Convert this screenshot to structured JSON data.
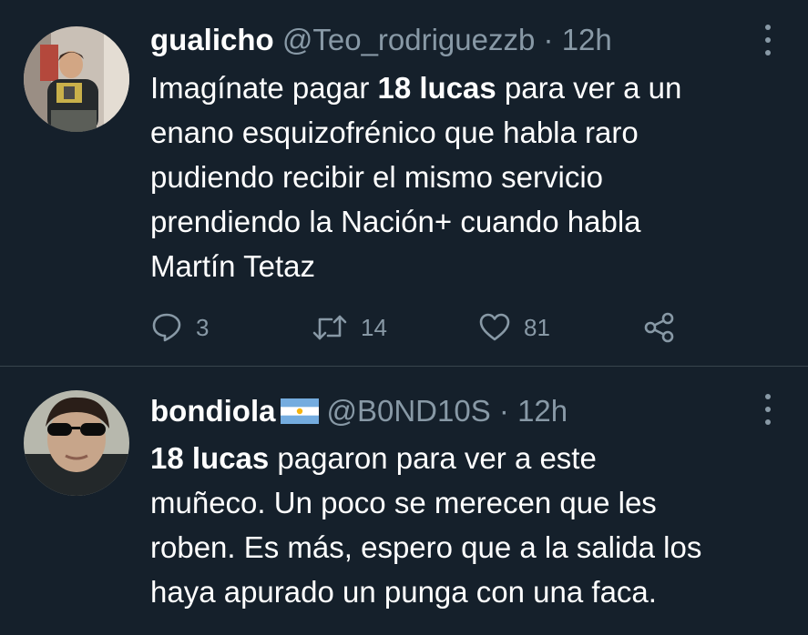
{
  "tweets": [
    {
      "author": "gualicho",
      "handle": "@Teo_rodriguezzb",
      "separator": "·",
      "time": "12h",
      "lines": [
        {
          "pre": "Imagínate pagar ",
          "bold": "18 lucas",
          "post": " para ver a un"
        },
        {
          "pre": "enano esquizofrénico que habla raro",
          "bold": "",
          "post": ""
        },
        {
          "pre": "pudiendo recibir el mismo servicio",
          "bold": "",
          "post": ""
        },
        {
          "pre": "prendiendo la Nación+ cuando habla",
          "bold": "",
          "post": ""
        },
        {
          "pre": "Martín Tetaz",
          "bold": "",
          "post": ""
        }
      ],
      "stats": {
        "replies": "3",
        "retweets": "14",
        "likes": "81"
      }
    },
    {
      "author": "bondiola",
      "flag": "argentina-flag-icon",
      "handle": "@B0ND10S",
      "separator": "·",
      "time": "12h",
      "lines": [
        {
          "pre": "",
          "bold": "18 lucas",
          "post": " pagaron para ver a este"
        },
        {
          "pre": "muñeco. Un poco se merecen que les",
          "bold": "",
          "post": ""
        },
        {
          "pre": "roben. Es más, espero que a la salida los",
          "bold": "",
          "post": ""
        },
        {
          "pre": "haya apurado un punga con una faca.",
          "bold": "",
          "post": ""
        }
      ]
    }
  ],
  "colors": {
    "background": "#15202b",
    "secondary_text": "#8899a6",
    "divider": "#38444d",
    "flag_blue": "#74acdf",
    "flag_sun": "#f6b40e"
  }
}
